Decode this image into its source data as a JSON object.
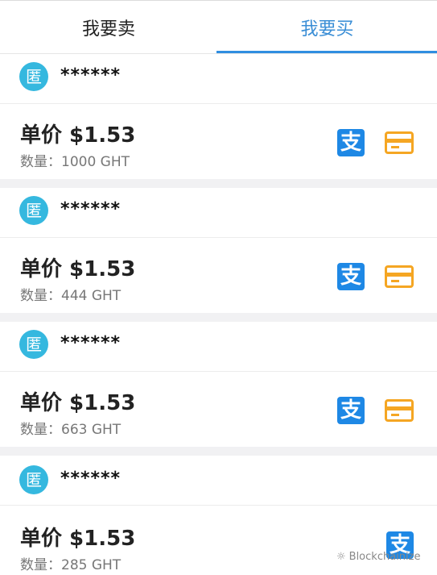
{
  "tabs": {
    "sell": "我要卖",
    "buy": "我要买",
    "active": "buy"
  },
  "avatar_char": "匿",
  "alipay_char": "支",
  "listings": [
    {
      "name": "******",
      "price": "单价 $1.53",
      "quantity": "数量：1000 GHT",
      "methods": [
        "alipay-icon",
        "bank-card-icon"
      ]
    },
    {
      "name": "******",
      "price": "单价 $1.53",
      "quantity": "数量：444 GHT",
      "methods": [
        "alipay-icon",
        "bank-card-icon"
      ]
    },
    {
      "name": "******",
      "price": "单价 $1.53",
      "quantity": "数量：663 GHT",
      "methods": [
        "alipay-icon",
        "bank-card-icon"
      ]
    },
    {
      "name": "******",
      "price": "单价 $1.53",
      "quantity": "数量：285 GHT",
      "methods": [
        "alipay-icon"
      ]
    }
  ],
  "watermark": {
    "icon": "wechat-icon",
    "text": "Blockchainize"
  },
  "colors": {
    "accent": "#2f8ee0",
    "avatar": "#35b8df",
    "alipay": "#1e88e5",
    "card": "#f5a623"
  }
}
